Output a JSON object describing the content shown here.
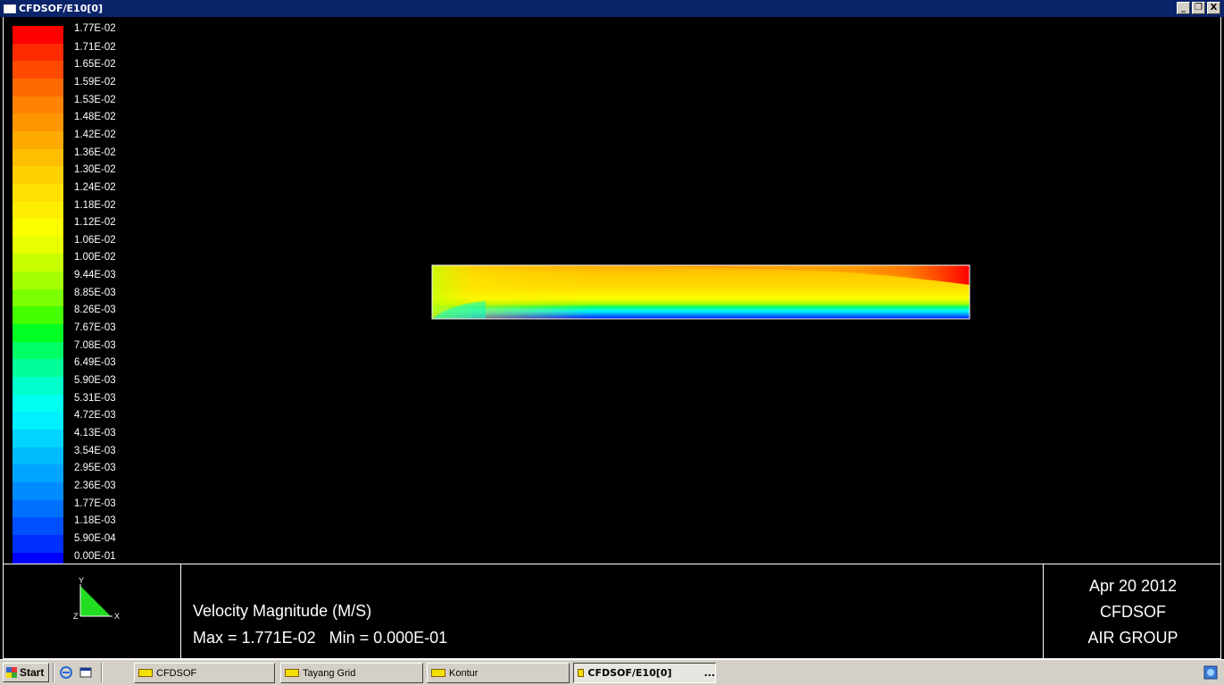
{
  "window": {
    "title": "CFDSOF/E10[0]",
    "buttons": [
      "_",
      "❐",
      "X"
    ]
  },
  "legend": {
    "labels": [
      "1.77E-02",
      "1.71E-02",
      "1.65E-02",
      "1.59E-02",
      "1.53E-02",
      "1.48E-02",
      "1.42E-02",
      "1.36E-02",
      "1.30E-02",
      "1.24E-02",
      "1.18E-02",
      "1.12E-02",
      "1.06E-02",
      "1.00E-02",
      "9.44E-03",
      "8.85E-03",
      "8.26E-03",
      "7.67E-03",
      "7.08E-03",
      "6.49E-03",
      "5.90E-03",
      "5.31E-03",
      "4.72E-03",
      "4.13E-03",
      "3.54E-03",
      "2.95E-03",
      "2.36E-03",
      "1.77E-03",
      "1.18E-03",
      "5.90E-04",
      "0.00E-01"
    ],
    "colors": [
      "#ff0000",
      "#ff2a00",
      "#ff4a00",
      "#ff6a00",
      "#ff8200",
      "#ff9600",
      "#ffaa00",
      "#ffbe00",
      "#ffd000",
      "#ffe000",
      "#ffee00",
      "#fcff00",
      "#e8ff00",
      "#c8ff00",
      "#a4ff00",
      "#7cff00",
      "#44ff00",
      "#00ff22",
      "#00ff66",
      "#00ff99",
      "#00ffcc",
      "#00ffee",
      "#00f0ff",
      "#00d4ff",
      "#00bcff",
      "#00a4ff",
      "#008cff",
      "#0070ff",
      "#0050ff",
      "#0030ff",
      "#0000ff"
    ]
  },
  "info": {
    "axis_y": "Y",
    "axis_x": "X",
    "axis_z": "Z",
    "variable": "Velocity Magnitude (M/S)",
    "maxmin": "Max = 1.771E-02   Min = 0.000E-01",
    "date": "Apr 20 2012",
    "app": "CFDSOF",
    "group": "AIR GROUP"
  },
  "taskbar": {
    "start_label": "Start",
    "tasks": [
      {
        "label": "CFDSOF",
        "active": false
      },
      {
        "label": "Tayang Grid",
        "active": false
      },
      {
        "label": "Kontur",
        "active": false
      },
      {
        "label": "CFDSOF/E10[0]",
        "active": true
      }
    ],
    "active_suffix": "..."
  }
}
